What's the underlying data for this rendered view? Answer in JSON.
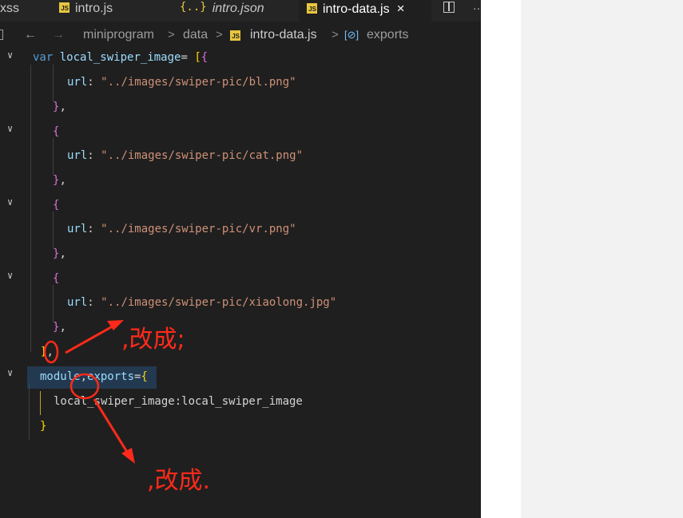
{
  "tabs": [
    {
      "label": "xss"
    },
    {
      "label": "intro.js",
      "icon": "js-file-icon"
    },
    {
      "label": "intro.json",
      "icon": "json-file-icon"
    },
    {
      "label": "intro-data.js",
      "icon": "js-file-icon",
      "active": true
    }
  ],
  "tab_actions": {
    "close": "×",
    "split": "split-editor-icon",
    "more": "···"
  },
  "breadcrumb": {
    "back": "←",
    "forward": "→",
    "items": [
      "miniprogram",
      "data",
      "intro-data.js",
      "exports"
    ],
    "separator": ">"
  },
  "code_lines": [
    {
      "kw": "var",
      "name": "local_swiper_image",
      "eq": "= ",
      "b1": "[",
      "b2": "{"
    },
    {
      "key": "url",
      "colon": ": ",
      "str": "\"../images/swiper-pic/bl.png\""
    },
    {
      "close": "}",
      "comma": ","
    },
    {
      "open": "{"
    },
    {
      "key": "url",
      "colon": ": ",
      "str": "\"../images/swiper-pic/cat.png\""
    },
    {
      "close": "}",
      "comma": ","
    },
    {
      "open": "{"
    },
    {
      "key": "url",
      "colon": ": ",
      "str": "\"../images/swiper-pic/vr.png\""
    },
    {
      "close": "}",
      "comma": ","
    },
    {
      "open": "{"
    },
    {
      "key": "url",
      "colon": ": ",
      "str": "\"../images/swiper-pic/xiaolong.jpg\""
    },
    {
      "close": "}",
      "comma": ","
    },
    {
      "close": "]",
      "comma": ","
    },
    {
      "a": "module",
      "dot": ",",
      "b": "exports",
      "eq": "=",
      "open": "{"
    },
    {
      "text": "local_swiper_image:local_swiper_image"
    },
    {
      "close": "}"
    }
  ],
  "annotations": [
    {
      "text": ",改成;"
    },
    {
      "text": ",改成."
    }
  ],
  "colors": {
    "editor_bg": "#1f1f1f",
    "annotation_red": "#ff2a1a",
    "keyword": "#569cd6",
    "string": "#ce9178"
  }
}
